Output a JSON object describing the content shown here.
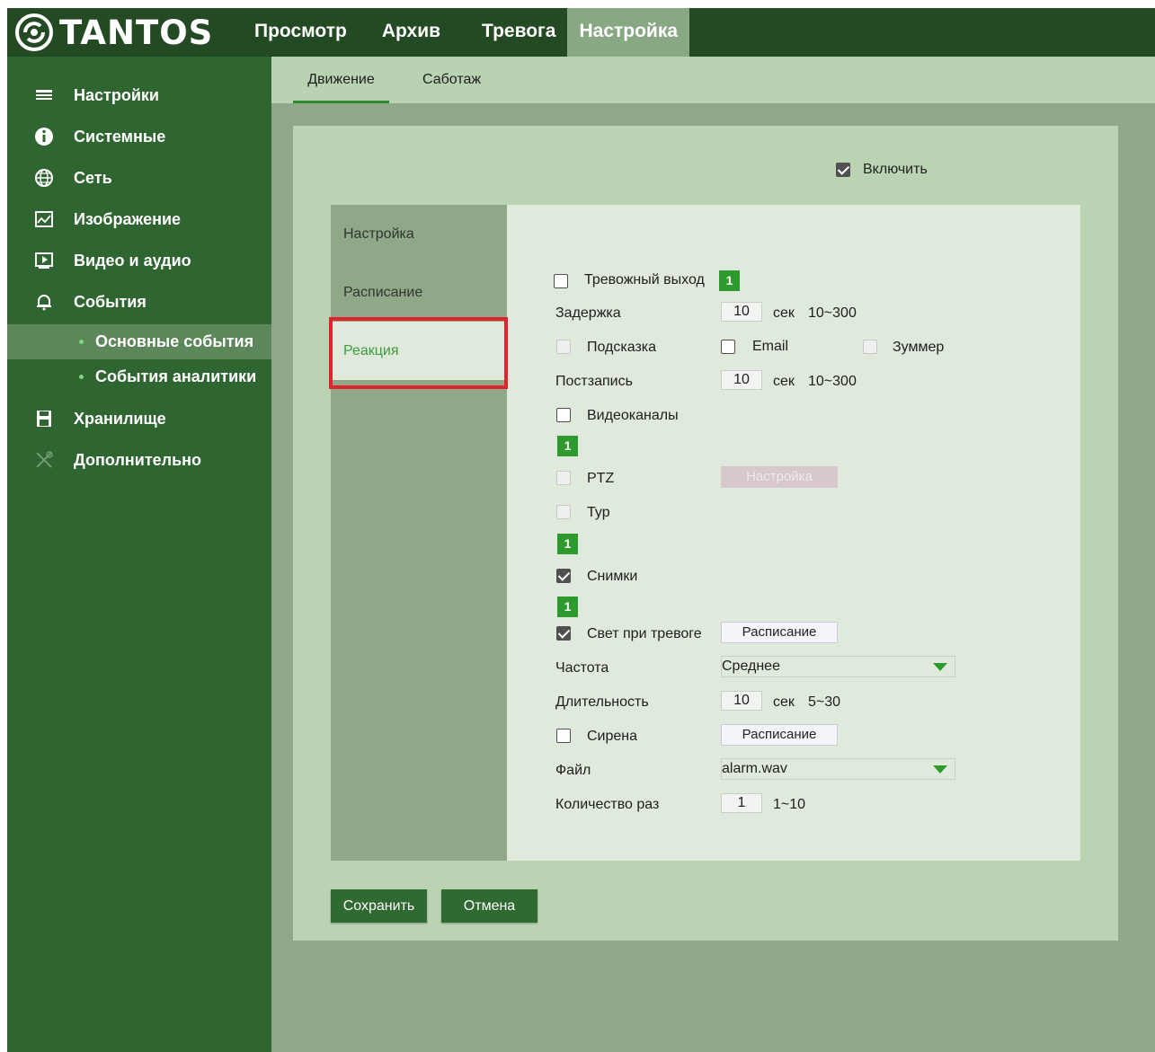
{
  "app": {
    "logo_text": "TANTOS"
  },
  "topnav": {
    "items": [
      "Просмотр",
      "Архив",
      "Тревога",
      "Настройка"
    ],
    "active": "Настройка"
  },
  "sidebar": {
    "items": [
      {
        "label": "Настройки",
        "icon": "list-icon"
      },
      {
        "label": "Системные",
        "icon": "info-icon"
      },
      {
        "label": "Сеть",
        "icon": "globe-icon"
      },
      {
        "label": "Изображение",
        "icon": "image-icon"
      },
      {
        "label": "Видео и аудио",
        "icon": "video-icon"
      },
      {
        "label": "События",
        "icon": "bell-icon"
      },
      {
        "label": "Хранилище",
        "icon": "floppy-icon"
      },
      {
        "label": "Дополнительно",
        "icon": "tools-icon"
      }
    ],
    "subitems": [
      {
        "label": "Основные события",
        "active": true
      },
      {
        "label": "События аналитики",
        "active": false
      }
    ]
  },
  "main_tabs": {
    "items": [
      "Движение",
      "Саботаж"
    ],
    "active": "Движение"
  },
  "panel": {
    "enable_label": "Включить",
    "enable_checked": true,
    "vertical_tabs": [
      "Настройка",
      "Расписание",
      "Реакция"
    ],
    "active_vertical_tab": "Реакция"
  },
  "form": {
    "alarm_out_label": "Тревожный выход",
    "alarm_out_channel": "1",
    "delay_label": "Задержка",
    "delay_value": "10",
    "delay_unit": "сек",
    "delay_range": "10~300",
    "hint_label": "Подсказка",
    "email_label": "Email",
    "buzzer_label": "Зуммер",
    "postrecord_label": "Постзапись",
    "postrecord_value": "10",
    "postrecord_unit": "сек",
    "postrecord_range": "10~300",
    "video_channels_label": "Видеоканалы",
    "video_channel": "1",
    "ptz_label": "PTZ",
    "ptz_setup_button": "Настройка",
    "tour_label": "Тур",
    "tour_channel": "1",
    "snapshots_label": "Снимки",
    "snapshots_channel": "1",
    "alarm_light_label": "Свет при тревоге",
    "alarm_light_schedule_button": "Расписание",
    "frequency_label": "Частота",
    "frequency_value": "Среднее",
    "duration_label": "Длительность",
    "duration_value": "10",
    "duration_unit": "сек",
    "duration_range": "5~30",
    "siren_label": "Сирена",
    "siren_schedule_button": "Расписание",
    "file_label": "Файл",
    "file_value": "alarm.wav",
    "count_label": "Количество раз",
    "count_value": "1",
    "count_range": "1~10"
  },
  "actions": {
    "save": "Сохранить",
    "cancel": "Отмена"
  },
  "colors": {
    "header": "#234a23",
    "sidebar": "#2f6530",
    "accent": "#2e9a2e",
    "highlight_frame": "#e0232e"
  }
}
